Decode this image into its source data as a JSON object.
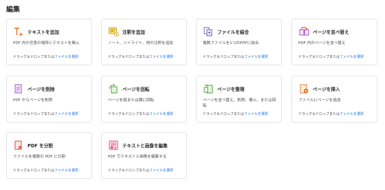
{
  "section_title": "編集",
  "drop_label": "ドラッグ＆ドロップまたは",
  "select_file_label": "ファイルを選択",
  "tools": [
    {
      "name": "テキストを追加",
      "desc": "PDF 内の任意の場所にテキストを挿入",
      "icon": "add-text-icon"
    },
    {
      "name": "注釈を追加",
      "desc": "ノート、ハイライト、他の注釈を追加",
      "icon": "add-comment-icon"
    },
    {
      "name": "ファイルを結合",
      "desc": "複数ファイルを1つのPDFに結合",
      "icon": "combine-files-icon"
    },
    {
      "name": "ページを並べ替え",
      "desc": "PDF 内のページを並べ替え",
      "icon": "reorder-pages-icon"
    },
    {
      "name": "ページを削除",
      "desc": "PDF からページを削除",
      "icon": "delete-pages-icon"
    },
    {
      "name": "ページを回転",
      "desc": "ページを縦または横に回転",
      "icon": "rotate-pages-icon"
    },
    {
      "name": "ページを整理",
      "desc": "ページを並べ替え、削除、挿入、または回転",
      "icon": "organize-pages-icon"
    },
    {
      "name": "ページを挿入",
      "desc": "ファイルにページを追加",
      "icon": "insert-pages-icon"
    },
    {
      "name": "PDF を分割",
      "desc": "ファイルを複数の PDF に分割",
      "icon": "split-pdf-icon"
    },
    {
      "name": "テキストと画像を編集",
      "desc": "PDF でテキストと画像を編集する",
      "icon": "edit-text-images-icon"
    }
  ]
}
